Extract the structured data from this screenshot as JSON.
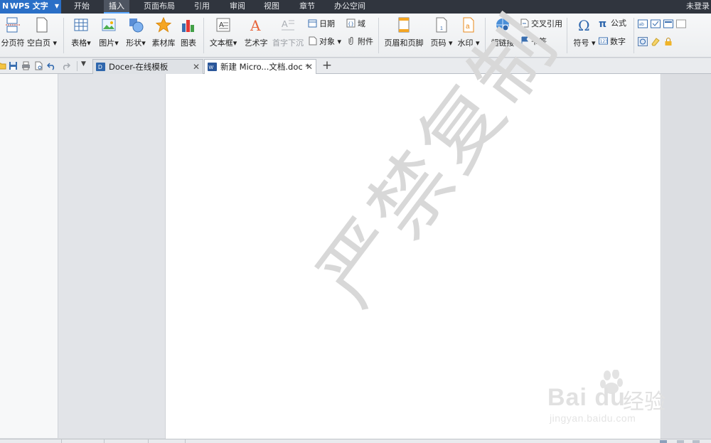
{
  "app": {
    "name": "WPS 文字"
  },
  "menu": {
    "items": [
      "开始",
      "插入",
      "页面布局",
      "引用",
      "审阅",
      "视图",
      "章节",
      "办公空间"
    ],
    "active": "插入",
    "login": "未登录"
  },
  "ribbon": {
    "page_break": "分页符",
    "blank_page": "空白页",
    "table": "表格",
    "picture": "图片",
    "shape": "形状",
    "material": "素材库",
    "chart": "图表",
    "textbox": "文本框",
    "wordart": "艺术字",
    "dropcap": "首字下沉",
    "date": "日期",
    "field": "域",
    "object": "对象",
    "attachment": "附件",
    "header_footer": "页眉和页脚",
    "page_number": "页码",
    "watermark": "水印",
    "hyperlink": "超链接",
    "cross_ref": "交叉引用",
    "bookmark": "书签",
    "symbol": "符号",
    "formula": "公式",
    "number": "数字"
  },
  "tabs": [
    {
      "label": "Docer-在线模板",
      "active": false
    },
    {
      "label": "新建 Micro...文档.doc *",
      "active": true
    }
  ],
  "document": {
    "watermark_text": "严禁复制"
  },
  "branding": {
    "logo_text": "Bai du",
    "logo_cn": "经验",
    "url": "jingyan.baidu.com"
  },
  "colors": {
    "menubar": "#30353e",
    "app_button": "#2a6fc7",
    "ribbon": "#f2f3f5",
    "page": "#ffffff",
    "watermark": "#d8d8d8"
  }
}
